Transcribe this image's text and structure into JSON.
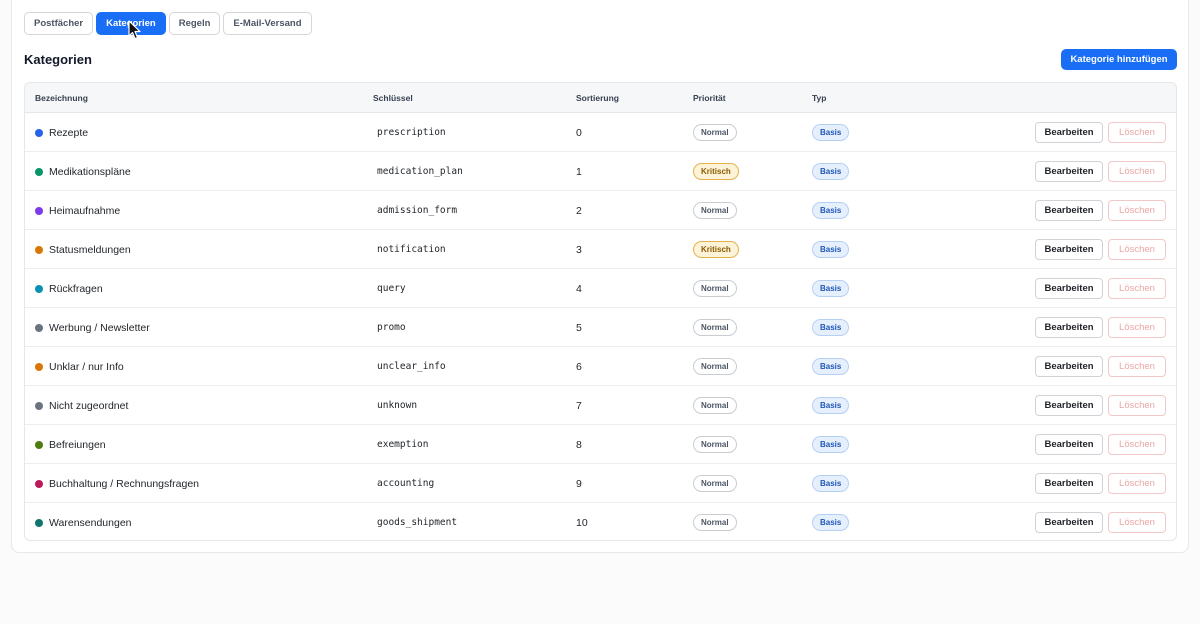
{
  "tabs": [
    {
      "label": "Postfächer",
      "active": false
    },
    {
      "label": "Kategorien",
      "active": true
    },
    {
      "label": "Regeln",
      "active": false
    },
    {
      "label": "E-Mail-Versand",
      "active": false
    }
  ],
  "section_title": "Kategorien",
  "add_button_label": "Kategorie hinzufügen",
  "columns": [
    "Bezeichnung",
    "Schlüssel",
    "Sortierung",
    "Priorität",
    "Typ"
  ],
  "actions": {
    "edit_label": "Bearbeiten",
    "delete_label": "Löschen"
  },
  "colors": {
    "accent": "#1a6ef5"
  },
  "rows": [
    {
      "name": "Rezepte",
      "key": "prescription",
      "sort": "0",
      "priority": "Normal",
      "type": "Basis",
      "color": "#2563eb"
    },
    {
      "name": "Medikationspläne",
      "key": "medication_plan",
      "sort": "1",
      "priority": "Kritisch",
      "type": "Basis",
      "color": "#059669"
    },
    {
      "name": "Heimaufnahme",
      "key": "admission_form",
      "sort": "2",
      "priority": "Normal",
      "type": "Basis",
      "color": "#7c3aed"
    },
    {
      "name": "Statusmeldungen",
      "key": "notification",
      "sort": "3",
      "priority": "Kritisch",
      "type": "Basis",
      "color": "#d97706"
    },
    {
      "name": "Rückfragen",
      "key": "query",
      "sort": "4",
      "priority": "Normal",
      "type": "Basis",
      "color": "#0891b2"
    },
    {
      "name": "Werbung / Newsletter",
      "key": "promo",
      "sort": "5",
      "priority": "Normal",
      "type": "Basis",
      "color": "#6b7280"
    },
    {
      "name": "Unklar / nur Info",
      "key": "unclear_info",
      "sort": "6",
      "priority": "Normal",
      "type": "Basis",
      "color": "#d97706"
    },
    {
      "name": "Nicht zugeordnet",
      "key": "unknown",
      "sort": "7",
      "priority": "Normal",
      "type": "Basis",
      "color": "#6b7280"
    },
    {
      "name": "Befreiungen",
      "key": "exemption",
      "sort": "8",
      "priority": "Normal",
      "type": "Basis",
      "color": "#4d7c0f"
    },
    {
      "name": "Buchhaltung / Rechnungsfragen",
      "key": "accounting",
      "sort": "9",
      "priority": "Normal",
      "type": "Basis",
      "color": "#be185d"
    },
    {
      "name": "Warensendungen",
      "key": "goods_shipment",
      "sort": "10",
      "priority": "Normal",
      "type": "Basis",
      "color": "#0f766e"
    }
  ]
}
